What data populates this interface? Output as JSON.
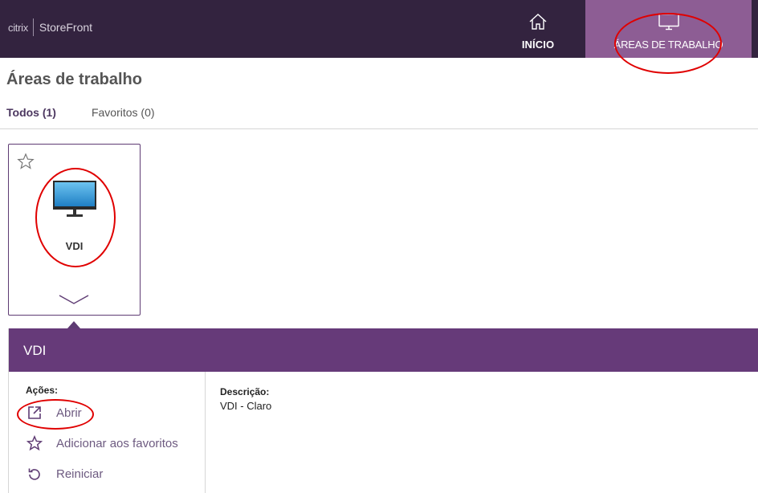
{
  "header": {
    "brand_citrix": "citrix",
    "brand_product": "StoreFront",
    "nav": [
      {
        "label": "INÍCIO",
        "icon": "home-icon"
      },
      {
        "label": "ÁREAS DE TRABALHO",
        "icon": "desktop-monitor-icon"
      }
    ],
    "colors": {
      "bar": "#33233f",
      "active": "#8d5d94"
    }
  },
  "page": {
    "title": "Áreas de trabalho",
    "tabs": [
      {
        "label": "Todos (1)",
        "active": true
      },
      {
        "label": "Favoritos (0)",
        "active": false
      }
    ]
  },
  "tile": {
    "name": "VDI",
    "icon": "desktop-monitor-icon",
    "favorite_icon": "star-outline-icon",
    "expand_icon": "chevron-down-icon"
  },
  "details": {
    "title": "VDI",
    "actions_label": "Ações:",
    "actions": [
      {
        "label": "Abrir",
        "icon": "open-external-icon"
      },
      {
        "label": "Adicionar aos favoritos",
        "icon": "star-outline-icon"
      },
      {
        "label": "Reiniciar",
        "icon": "restart-icon"
      }
    ],
    "description_label": "Descrição:",
    "description_value": "VDI - Claro",
    "colors": {
      "header": "#663a79",
      "action_text": "#6d5a80"
    }
  },
  "annotation_color": "#e00000"
}
